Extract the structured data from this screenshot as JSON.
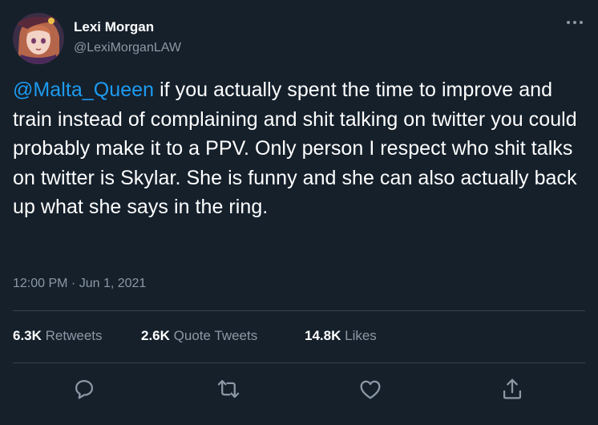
{
  "user": {
    "display_name": "Lexi Morgan",
    "handle": "@LexiMorganLAW"
  },
  "tweet": {
    "mention": "@Malta_Queen",
    "body": " if you actually spent the time to improve and train instead of complaining and shit talking on twitter you could probably make it to a PPV. Only person I respect who shit talks on twitter is Skylar. She is funny and she can also actually back up what she says in the ring.",
    "timestamp": "12:00 PM · Jun 1, 2021"
  },
  "stats": {
    "retweets_count": "6.3K",
    "retweets_label": "Retweets",
    "quote_count": "2.6K",
    "quote_label": "Quote Tweets",
    "likes_count": "14.8K",
    "likes_label": "Likes"
  },
  "icons": {
    "more": "more-icon",
    "reply": "reply-icon",
    "retweet": "retweet-icon",
    "like": "like-icon",
    "share": "share-icon"
  },
  "colors": {
    "background": "#15202b",
    "mention": "#1d9bf0",
    "secondary_text": "#8b98a5",
    "divider": "#38444d"
  }
}
